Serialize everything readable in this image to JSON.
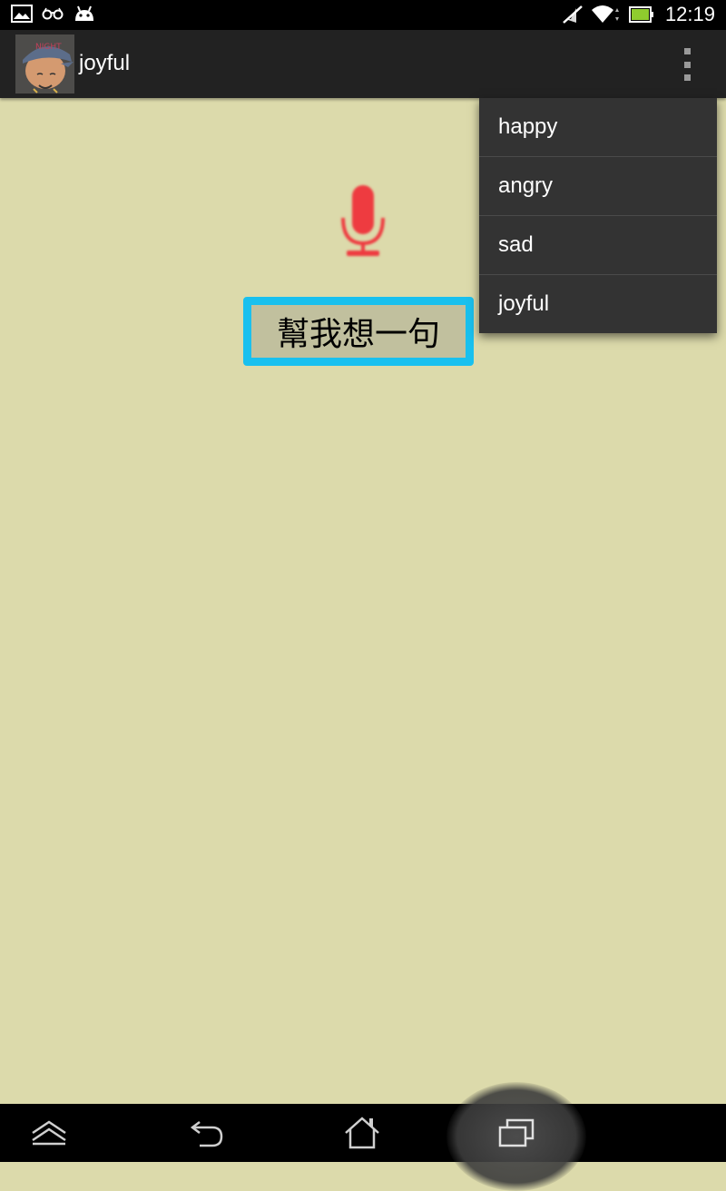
{
  "status_bar": {
    "time": "12:19",
    "icons_left": [
      "gallery-icon",
      "glasses-icon",
      "android-icon"
    ],
    "icons_right": [
      "mute-icon",
      "wifi-icon",
      "battery-icon"
    ]
  },
  "action_bar": {
    "title": "joyful",
    "app_icon": "cartoon-avatar",
    "overflow_icon": "overflow-menu-icon"
  },
  "main": {
    "mic_icon": "microphone-icon",
    "button_label": "幫我想一句",
    "mic_color": "#e8343a",
    "button_border_color": "#19c0ee"
  },
  "dropdown_menu": {
    "items": [
      {
        "label": "happy"
      },
      {
        "label": "angry"
      },
      {
        "label": "sad"
      },
      {
        "label": "joyful"
      }
    ]
  },
  "nav_bar": {
    "buttons": [
      "hide-keyboard-icon",
      "back-icon",
      "home-icon",
      "recent-apps-icon"
    ]
  },
  "colors": {
    "background": "#dcdaab",
    "action_bar": "#222222",
    "menu": "#333333"
  }
}
